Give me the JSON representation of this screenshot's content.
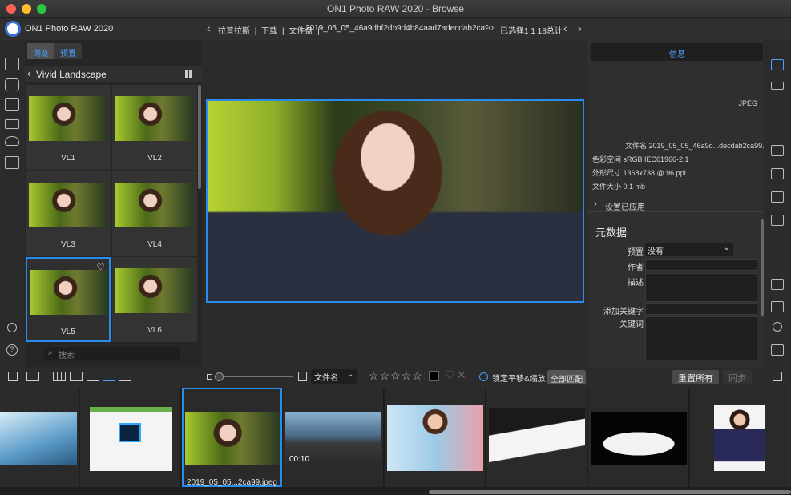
{
  "window": {
    "title": "ON1 Photo RAW 2020 - Browse"
  },
  "header": {
    "app_name": "ON1 Photo RAW 2020",
    "breadcrumbs": [
      "拉普拉斯",
      "|",
      "下载",
      "|",
      "文件盘",
      "|",
      "2019_05_05_46a9dbf2db9d4b84aad7adecdab2ca99.jpeg"
    ],
    "selection": "已选择1 1 18总计"
  },
  "browser": {
    "tabs": [
      "浏览",
      "预置"
    ],
    "folder": "Vivid Landscape",
    "presets": [
      "VL1",
      "VL2",
      "VL3",
      "VL4",
      "VL5",
      "VL6"
    ],
    "search_placeholder": "搜索"
  },
  "info": {
    "header": "信息",
    "format": "JPEG",
    "filename": "文件名 2019_05_05_46a9d...decdab2ca99.jpeg",
    "colorspace": "色彩空间 sRGB IEC61966-2.1",
    "dimensions": "外形尺寸 1368x738 @ 96 ppi",
    "filesize": "文件大小 0.1 mb",
    "settings_applied": "设置已应用",
    "metadata_title": "元数据",
    "preset_label": "预置",
    "preset_value": "没有",
    "author_label": "作者",
    "desc_label": "描述",
    "add_keyword_label": "添加关键字",
    "keywords_label": "关键词"
  },
  "toolbar": {
    "sort_label": "文件名",
    "lock_label": "锁定平移&缩放",
    "match_all": "全部匹配",
    "reset_all": "重置所有",
    "sync": "同步"
  },
  "filmstrip": {
    "selected_name": "2019_05_05...2ca99.jpeg",
    "video_duration": "00:10"
  },
  "colors": {
    "accent": "#2b8cf0",
    "accent_text": "#4aa3ff"
  }
}
